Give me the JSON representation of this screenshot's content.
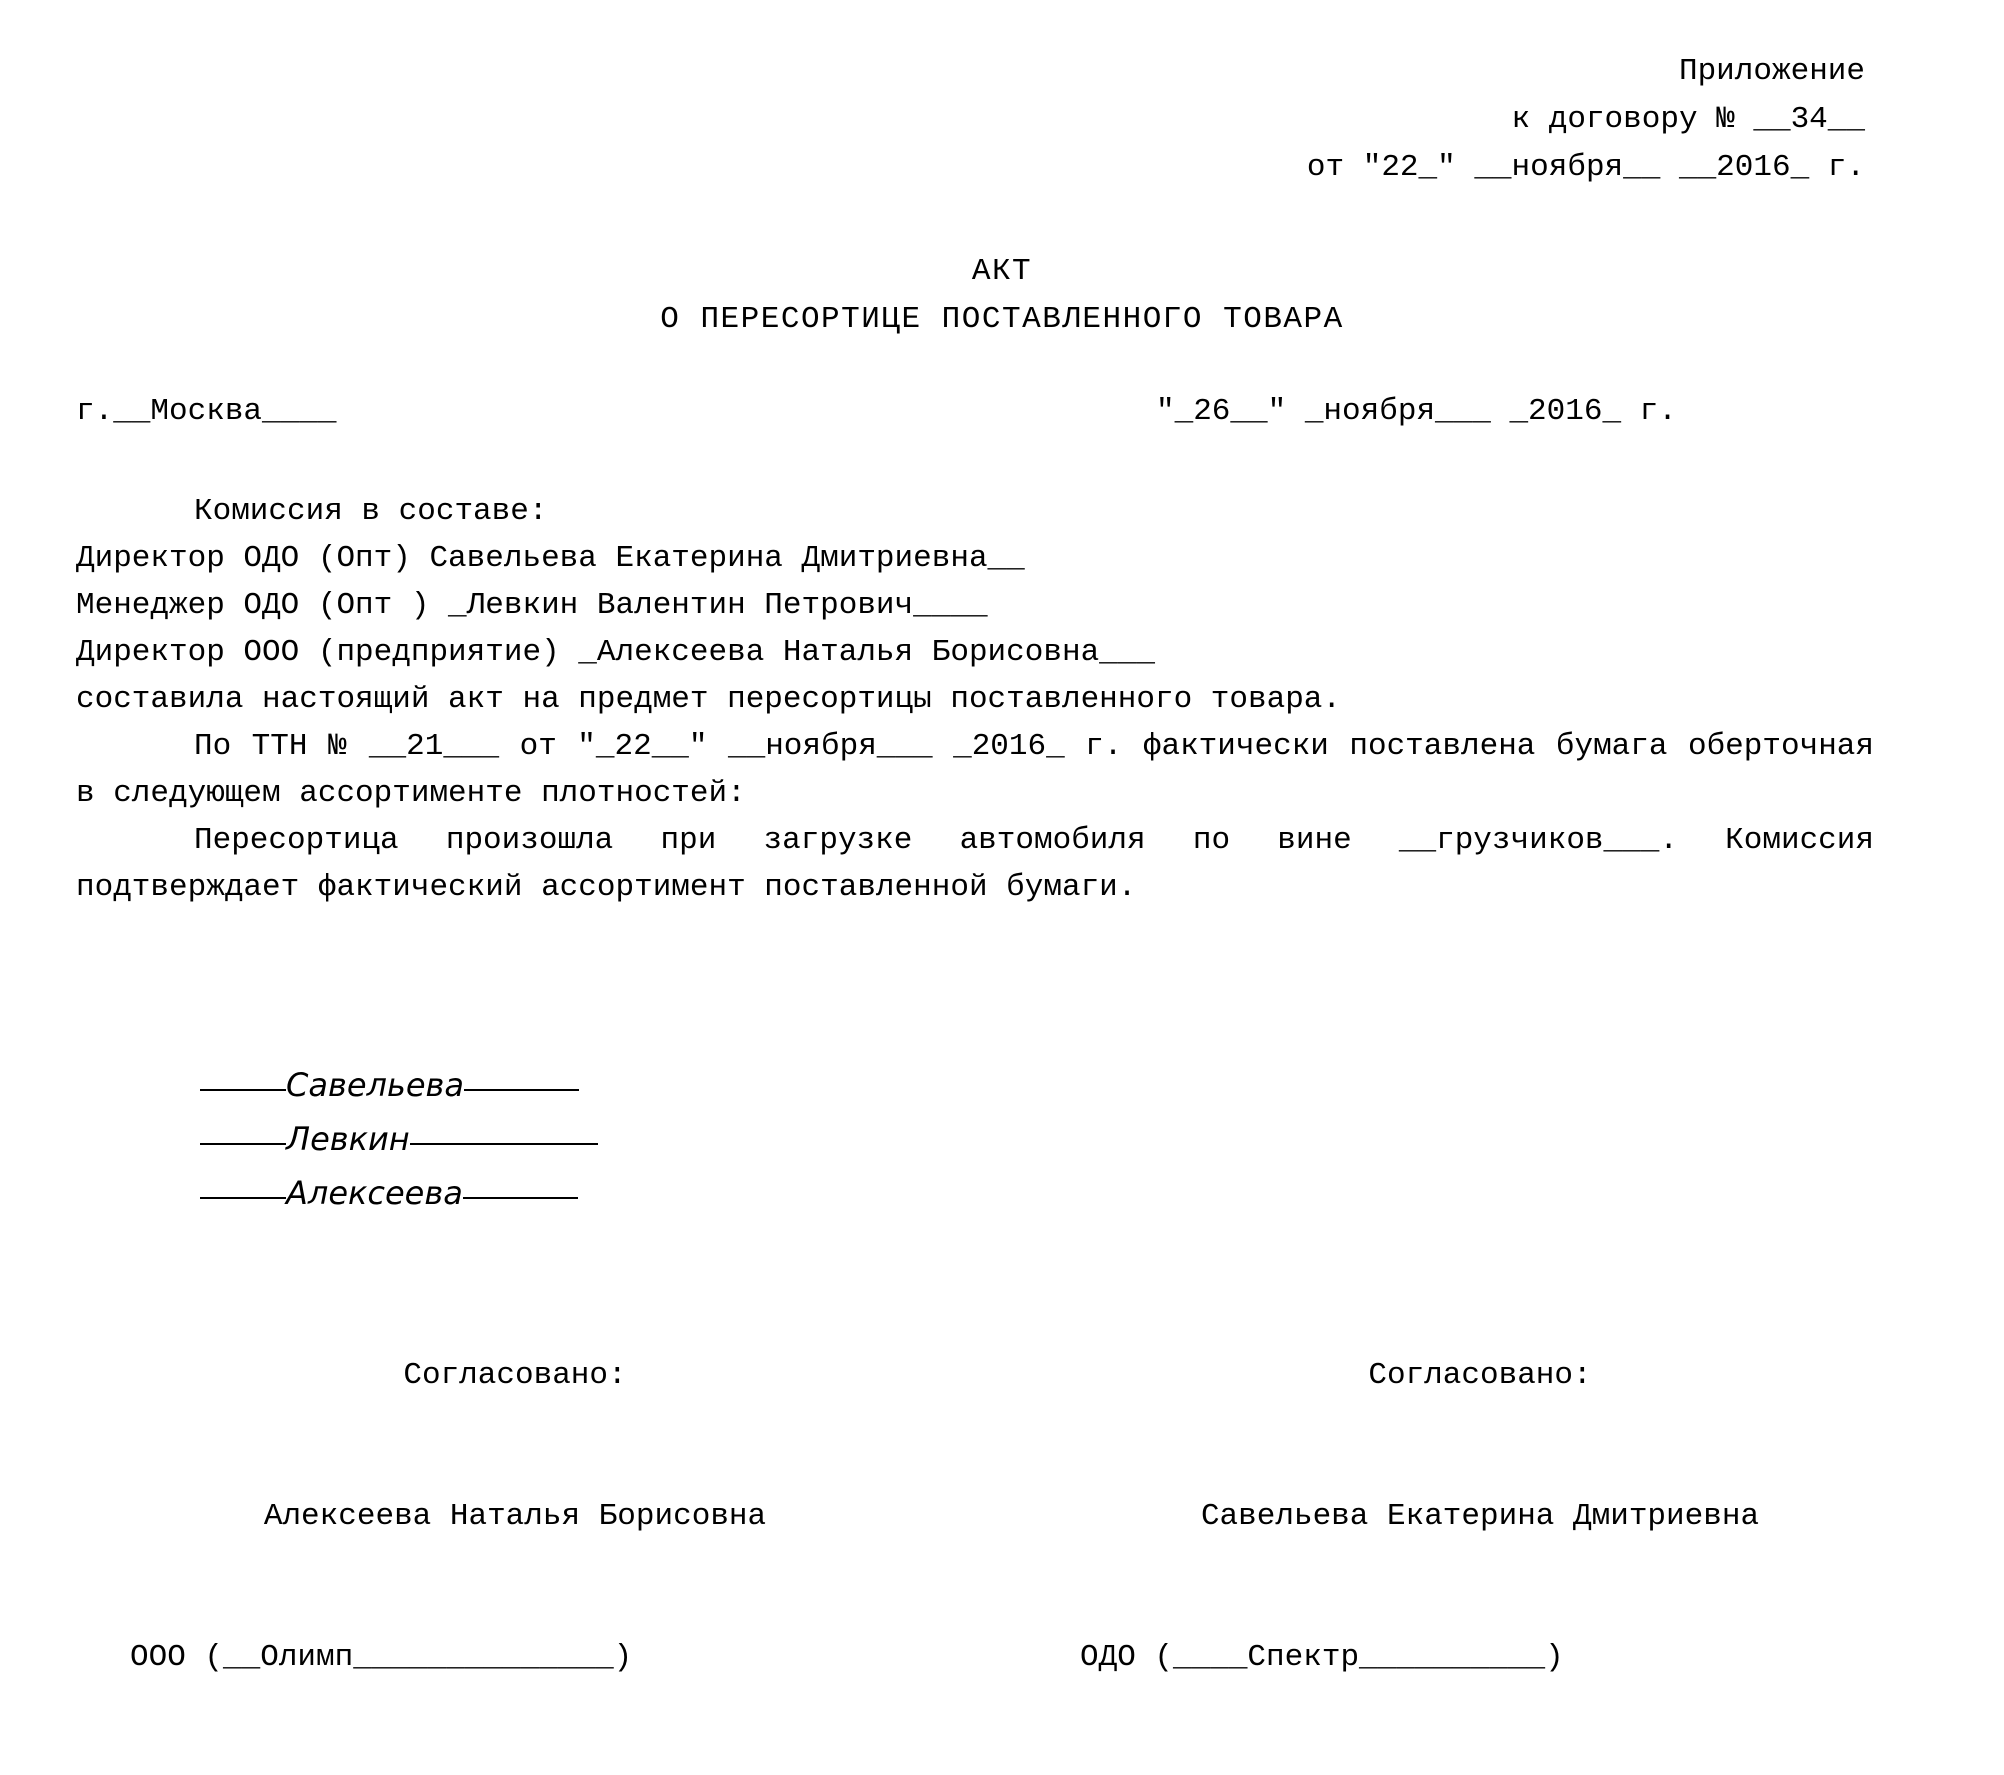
{
  "document": {
    "type": "act",
    "language": "ru",
    "header": {
      "line1": "Приложение",
      "line2": "к договору № __34__",
      "line3": "от \"22_\" __ноября__ __2016_ г."
    },
    "title": {
      "line1": "АКТ",
      "line2": "О ПЕРЕСОРТИЦЕ ПОСТАВЛЕННОГО ТОВАРА"
    },
    "city_date": {
      "city": "г.__Москва____",
      "date": "\"_26__\" _ноября___ _2016_ г."
    },
    "commission": {
      "intro": "Комиссия в составе:",
      "members": [
        "Директор ОДО (Опт) Савельева Екатерина Дмитриевна__",
        "Менеджер ОДО (Опт ) _Левкин Валентин Петрович____",
        "Директор ООО (предприятие) _Алексеева Наталья Борисовна___"
      ]
    },
    "body": {
      "paragraph1": "составила настоящий акт на предмет пересортицы поставленного товара.",
      "paragraph2": "По ТТН № __21___ от \"_22__\" __ноября___ _2016_ г. фактически поставлена бумага оберточная в следующем ассортименте плотностей:",
      "paragraph3": "Пересортица произошла при загрузке автомобиля по вине __грузчиков___. Комиссия подтверждает фактический ассортимент поставленной бумаги."
    },
    "signatures": [
      {
        "name": "Савельева"
      },
      {
        "name": "Левкин"
      },
      {
        "name": "Алексеева"
      }
    ],
    "approvals": {
      "left": {
        "heading": "Согласовано:",
        "name": "Алексеева Наталья Борисовна",
        "org": "ООО (__Олимп______________)"
      },
      "right": {
        "heading": "Согласовано:",
        "name": "Савельева Екатерина Дмитриевна",
        "org": "ОДО (____Спектр__________)"
      }
    }
  }
}
